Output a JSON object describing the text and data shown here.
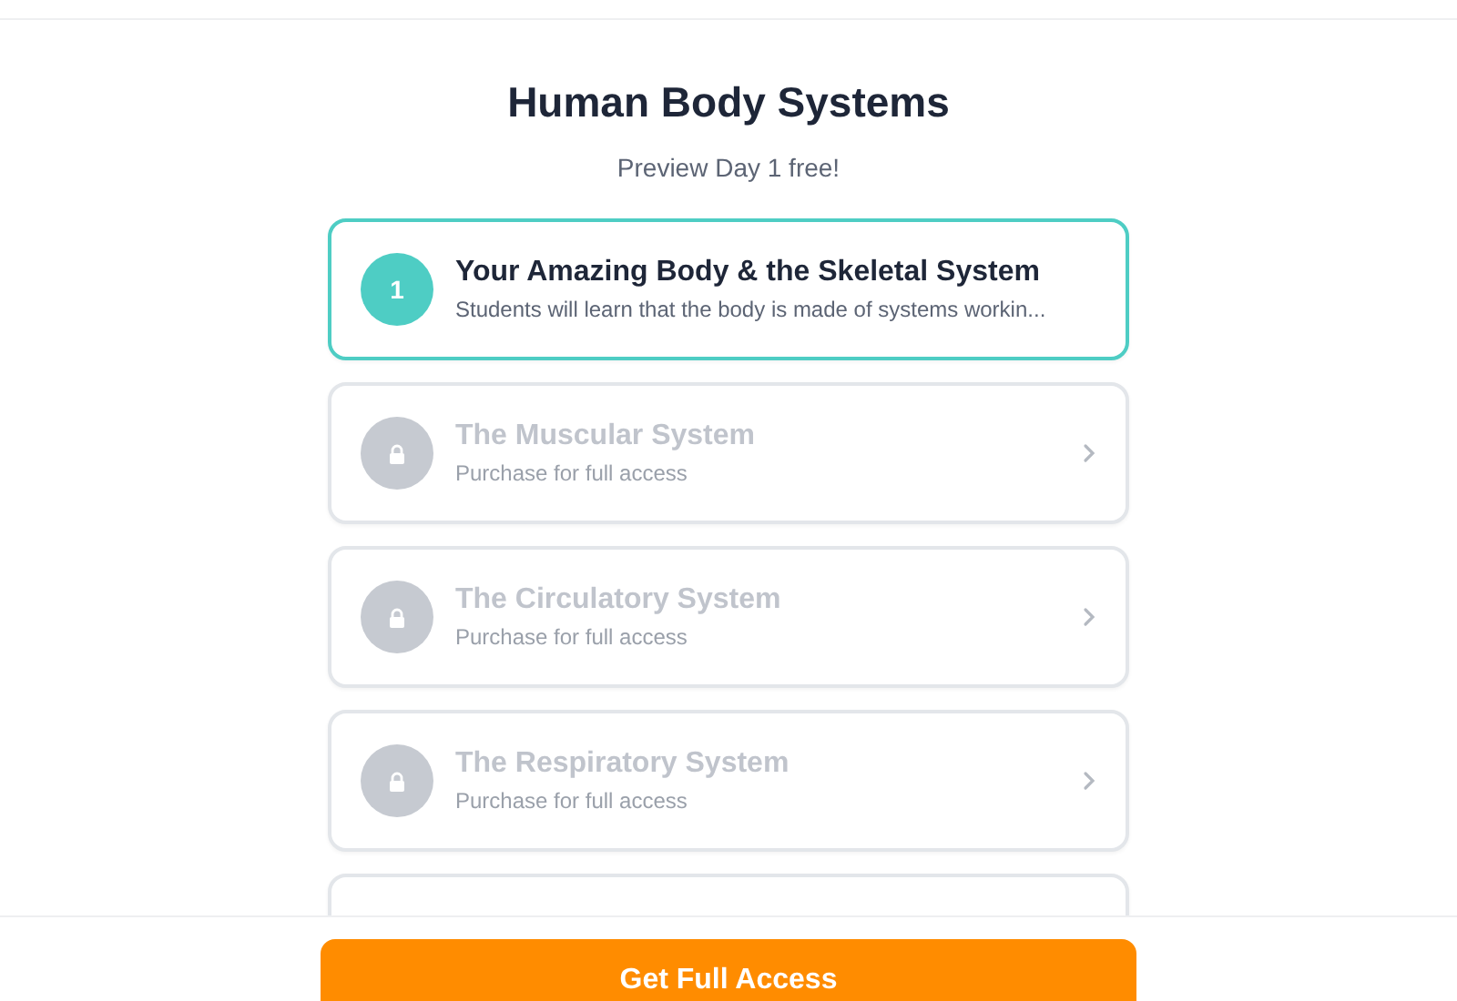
{
  "title": "Human Body Systems",
  "subtitle": "Preview Day 1 free!",
  "lessons": [
    {
      "kind": "open",
      "badge": "1",
      "title": "Your Amazing Body & the Skeletal System",
      "description": "Students will learn that the body is made of systems workin...",
      "selected": true
    },
    {
      "kind": "locked",
      "title": "The Muscular System",
      "description": "Purchase for full access",
      "selected": false
    },
    {
      "kind": "locked",
      "title": "The Circulatory System",
      "description": "Purchase for full access",
      "selected": false
    },
    {
      "kind": "locked",
      "title": "The Respiratory System",
      "description": "Purchase for full access",
      "selected": false
    }
  ],
  "cta": "Get Full Access"
}
